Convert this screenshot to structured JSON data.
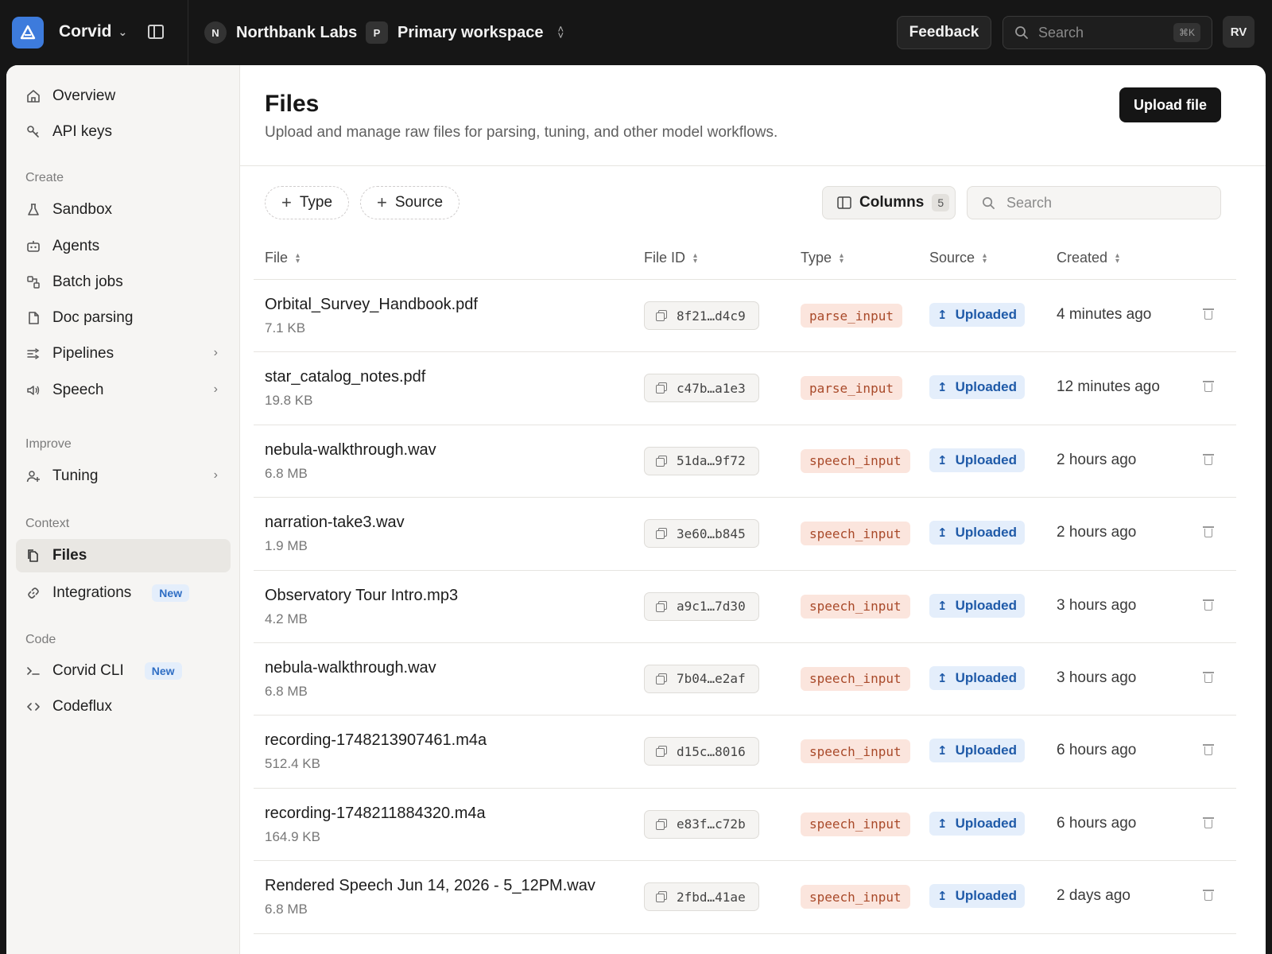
{
  "topbar": {
    "app_name": "Corvid",
    "org_initial": "N",
    "org_name": "Northbank Labs",
    "workspace_initial": "P",
    "workspace_name": "Primary workspace",
    "feedback_label": "Feedback",
    "search_placeholder": "Search",
    "search_shortcut": "⌘K",
    "avatar_initials": "RV"
  },
  "sidebar": {
    "top_items": [
      {
        "label": "Overview",
        "icon": "home-icon"
      },
      {
        "label": "API keys",
        "icon": "key-icon"
      }
    ],
    "sections": [
      {
        "label": "Create",
        "items": [
          {
            "label": "Sandbox",
            "icon": "flask-icon"
          },
          {
            "label": "Agents",
            "icon": "robot-icon"
          },
          {
            "label": "Batch jobs",
            "icon": "batch-icon"
          },
          {
            "label": "Doc parsing",
            "icon": "document-icon"
          },
          {
            "label": "Pipelines",
            "icon": "pipelines-icon",
            "expandable": true
          },
          {
            "label": "Speech",
            "icon": "speaker-icon",
            "expandable": true
          }
        ]
      },
      {
        "label": "Improve",
        "items": [
          {
            "label": "Tuning",
            "icon": "user-plus-icon",
            "expandable": true
          }
        ]
      },
      {
        "label": "Context",
        "items": [
          {
            "label": "Files",
            "icon": "files-icon",
            "active": true
          },
          {
            "label": "Integrations",
            "icon": "link-icon",
            "badge": "New"
          }
        ]
      },
      {
        "label": "Code",
        "items": [
          {
            "label": "Corvid CLI",
            "icon": "terminal-icon",
            "badge": "New"
          },
          {
            "label": "Codeflux",
            "icon": "code-icon"
          }
        ]
      }
    ]
  },
  "main": {
    "title": "Files",
    "subtitle": "Upload and manage raw files for parsing, tuning, and other model workflows.",
    "upload_label": "Upload file",
    "filters": {
      "type_label": "Type",
      "source_label": "Source"
    },
    "columns_label": "Columns",
    "columns_count": "5",
    "search_placeholder": "Search",
    "table": {
      "headers": {
        "file": "File",
        "file_id": "File ID",
        "type": "Type",
        "source": "Source",
        "created": "Created"
      },
      "rows": [
        {
          "name": "Orbital_Survey_Handbook.pdf",
          "size": "7.1 KB",
          "id": "8f21…d4c9",
          "type": "parse_input",
          "source": "Uploaded",
          "created": "4 minutes ago"
        },
        {
          "name": "star_catalog_notes.pdf",
          "size": "19.8 KB",
          "id": "c47b…a1e3",
          "type": "parse_input",
          "source": "Uploaded",
          "created": "12 minutes ago"
        },
        {
          "name": "nebula-walkthrough.wav",
          "size": "6.8 MB",
          "id": "51da…9f72",
          "type": "speech_input",
          "source": "Uploaded",
          "created": "2 hours ago"
        },
        {
          "name": "narration-take3.wav",
          "size": "1.9 MB",
          "id": "3e60…b845",
          "type": "speech_input",
          "source": "Uploaded",
          "created": "2 hours ago"
        },
        {
          "name": "Observatory Tour Intro.mp3",
          "size": "4.2 MB",
          "id": "a9c1…7d30",
          "type": "speech_input",
          "source": "Uploaded",
          "created": "3 hours ago"
        },
        {
          "name": "nebula-walkthrough.wav",
          "size": "6.8 MB",
          "id": "7b04…e2af",
          "type": "speech_input",
          "source": "Uploaded",
          "created": "3 hours ago"
        },
        {
          "name": "recording-1748213907461.m4a",
          "size": "512.4 KB",
          "id": "d15c…8016",
          "type": "speech_input",
          "source": "Uploaded",
          "created": "6 hours ago"
        },
        {
          "name": "recording-1748211884320.m4a",
          "size": "164.9 KB",
          "id": "e83f…c72b",
          "type": "speech_input",
          "source": "Uploaded",
          "created": "6 hours ago"
        },
        {
          "name": "Rendered Speech Jun 14, 2026 - 5_12PM.wav",
          "size": "6.8 MB",
          "id": "2fbd…41ae",
          "type": "speech_input",
          "source": "Uploaded",
          "created": "2 days ago"
        }
      ]
    }
  },
  "colors": {
    "topbar_bg": "#161616",
    "logo_accent": "#3d7bdc",
    "type_tag_bg": "#fbe5dd",
    "type_tag_fg": "#a94a2a",
    "source_tag_bg": "#e4eefb",
    "source_tag_fg": "#1f5aa8"
  }
}
